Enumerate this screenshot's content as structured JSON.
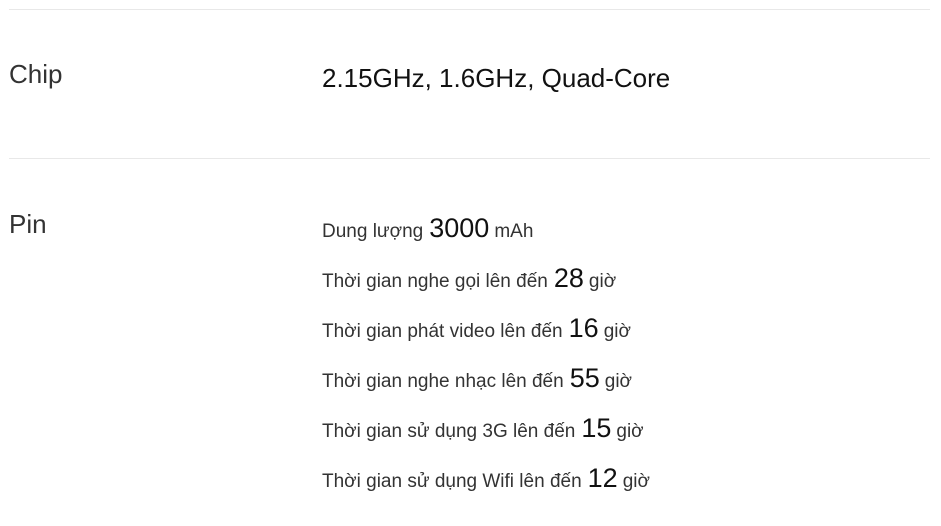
{
  "chip": {
    "label": "Chip",
    "value": "2.15GHz, 1.6GHz, Quad-Core"
  },
  "battery": {
    "label": "Pin",
    "lines": [
      {
        "prefix": "Dung lượng",
        "value": "3000",
        "suffix": "mAh"
      },
      {
        "prefix": "Thời gian nghe gọi lên đến",
        "value": "28",
        "suffix": "giờ"
      },
      {
        "prefix": "Thời gian phát video lên đến",
        "value": "16",
        "suffix": "giờ"
      },
      {
        "prefix": "Thời gian nghe nhạc lên đến",
        "value": "55",
        "suffix": "giờ"
      },
      {
        "prefix": "Thời gian sử dụng 3G lên đến",
        "value": "15",
        "suffix": "giờ"
      },
      {
        "prefix": "Thời gian sử dụng Wifi lên đến",
        "value": "12",
        "suffix": "giờ"
      }
    ]
  }
}
